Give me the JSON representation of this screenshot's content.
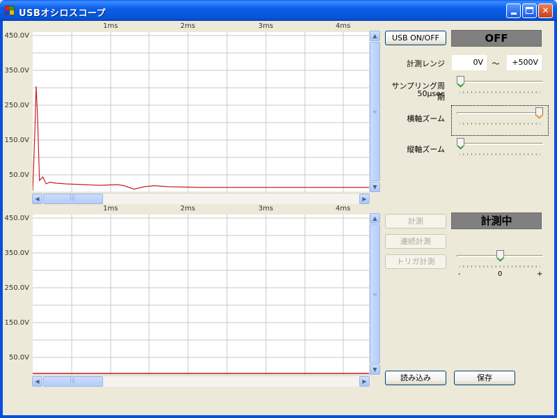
{
  "window": {
    "title": "USBオシロスコープ",
    "min_symbol": "",
    "max_symbol": "",
    "close_symbol": "✕"
  },
  "plot_top": {
    "x_ticks": [
      "1ms",
      "2ms",
      "3ms",
      "4ms"
    ],
    "y_labels": [
      "450.0V",
      "350.0V",
      "250.0V",
      "150.0V",
      "50.0V"
    ],
    "trace_color": "#c81e1e",
    "trace": [
      [
        0.0,
        0
      ],
      [
        0.06,
        160
      ],
      [
        0.1,
        300
      ],
      [
        0.14,
        220
      ],
      [
        0.2,
        30
      ],
      [
        0.3,
        40
      ],
      [
        0.4,
        20
      ],
      [
        0.5,
        25
      ],
      [
        0.7,
        22
      ],
      [
        1.0,
        20
      ],
      [
        1.5,
        18
      ],
      [
        2.0,
        16
      ],
      [
        2.5,
        18
      ],
      [
        2.7,
        15
      ],
      [
        3.0,
        5
      ],
      [
        3.3,
        12
      ],
      [
        3.6,
        15
      ],
      [
        4.0,
        12
      ],
      [
        4.5,
        11
      ],
      [
        5.0,
        10
      ],
      [
        6.0,
        10
      ],
      [
        7.0,
        10
      ],
      [
        8.0,
        10
      ],
      [
        9.0,
        10
      ],
      [
        10.0,
        10
      ]
    ]
  },
  "plot_bottom": {
    "x_ticks": [
      "1ms",
      "2ms",
      "3ms",
      "4ms"
    ],
    "y_labels": [
      "450.0V",
      "350.0V",
      "250.0V",
      "150.0V",
      "50.0V"
    ],
    "trace_color": "#c81e1e",
    "trace_level": 0
  },
  "controls": {
    "usb_button": "USB ON/OFF",
    "usb_status": "OFF",
    "range_label": "計測レンジ",
    "range_min": "0V",
    "range_tilde": "〜",
    "range_max": "+500V",
    "sampling_label": "サンプリング周期",
    "sampling_value": "50μsec",
    "hzoom_label": "横軸ズーム",
    "vzoom_label": "縦軸ズーム",
    "measure_button": "計測",
    "measure_status": "計測中",
    "continuous_button": "連続計測",
    "trigger_button": "トリガ計測",
    "trigger_minus": "-",
    "trigger_zero": "0",
    "trigger_plus": "+",
    "load_button": "読み込み",
    "save_button": "保存"
  },
  "sliders": {
    "sampling_level": 0.0,
    "hzoom_level": 1.0,
    "vzoom_level": 0.0,
    "trigger_level": 0.5
  },
  "colors": {
    "grid": "#c8c8c8",
    "thumb_orange": "#f0a030",
    "thumb_green": "#38a838",
    "status_gray": "#808080"
  }
}
